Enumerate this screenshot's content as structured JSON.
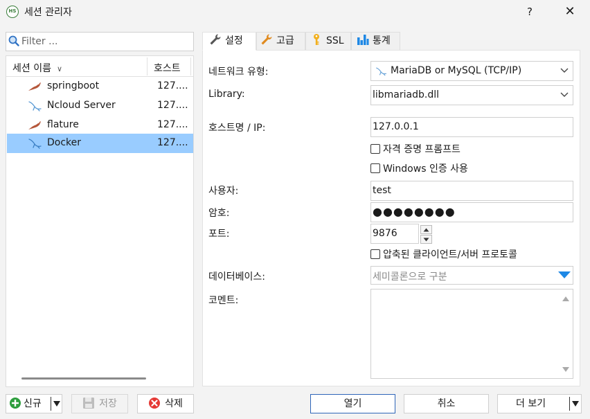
{
  "window": {
    "title": "세션 관리자",
    "help": "?",
    "close": "✕",
    "app_icon_text": "HS"
  },
  "filter": {
    "placeholder": "Filter ..."
  },
  "list": {
    "columns": [
      "세션 이름",
      "호스트"
    ],
    "rows": [
      {
        "name": "springboot",
        "host": "127....",
        "icon": "mariadb-icon",
        "selected": false
      },
      {
        "name": "Ncloud Server",
        "host": "127....",
        "icon": "mysql-dolphin-icon",
        "selected": false
      },
      {
        "name": "flature",
        "host": "127....",
        "icon": "mariadb-icon",
        "selected": false
      },
      {
        "name": "Docker",
        "host": "127....",
        "icon": "mysql-dolphin-icon",
        "selected": true
      }
    ]
  },
  "tabs": [
    {
      "label": "설정",
      "icon": "wrench-icon",
      "active": true
    },
    {
      "label": "고급",
      "icon": "wrench-orange-icon",
      "active": false
    },
    {
      "label": "SSL",
      "icon": "key-icon",
      "active": false
    },
    {
      "label": "통계",
      "icon": "bar-chart-icon",
      "active": false
    }
  ],
  "form": {
    "network_type_label": "네트워크 유형:",
    "network_type_value": "MariaDB or MySQL (TCP/IP)",
    "library_label": "Library:",
    "library_value": "libmariadb.dll",
    "host_label": "호스트명 / IP:",
    "host_value": "127.0.0.1",
    "credential_prompt": "자격 증명 프롬프트",
    "windows_auth": "Windows 인증 사용",
    "user_label": "사용자:",
    "user_value": "test",
    "password_label": "암호:",
    "password_value": "●●●●●●●●",
    "port_label": "포트:",
    "port_value": "9876",
    "compressed": "압축된 클라이언트/서버 프로토콜",
    "database_label": "데이터베이스:",
    "database_placeholder": "세미콜론으로 구분",
    "comment_label": "코멘트:"
  },
  "buttons": {
    "new": "신규",
    "save": "저장",
    "delete": "삭제",
    "open": "열기",
    "cancel": "취소",
    "more": "더 보기"
  },
  "colors": {
    "selected_row": "#99ccff",
    "primary_border": "#2d64b8",
    "accent_blue": "#1e88e5"
  }
}
